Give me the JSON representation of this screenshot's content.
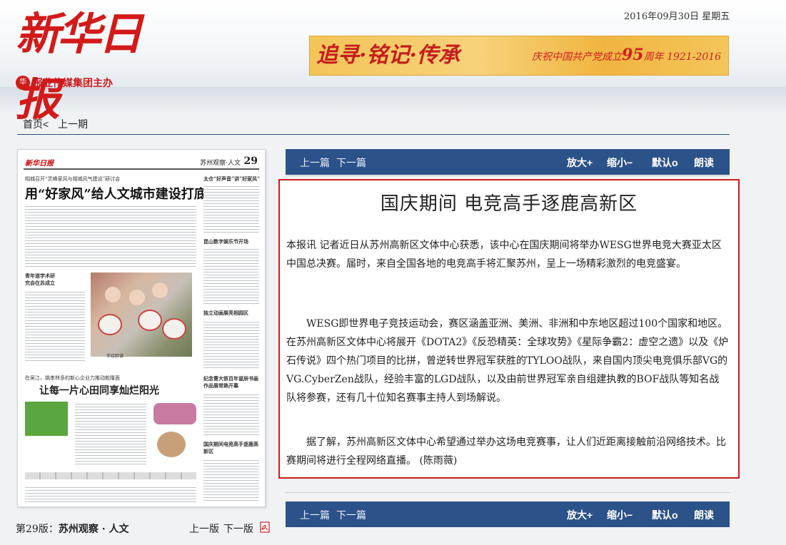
{
  "header": {
    "logo_text": "新华日报",
    "logo_sub": "报业传媒集团主办",
    "date": "2016年09月30日 星期五",
    "banner": {
      "left_text": "追寻·铭记·传承",
      "right_prefix": "庆祝中国共产党成立",
      "right_number": "95",
      "right_suffix": "周年 1921-2016"
    }
  },
  "breadcrumb": {
    "home": "首页<",
    "prev_issue": "上一期"
  },
  "thumbnail": {
    "mast_logo": "新华日报",
    "mast_section": "苏州观察·人文",
    "mast_number": "29",
    "kicker": "相城召开“灵峰家风与相城风气建设”研讨会",
    "headline": "用“好家风”给人文城市建设打底",
    "side_head_1": "太仓“好声音”讲“好家风”",
    "side_head_2": "昆山数字娱乐节开场",
    "left_section": "青年道学术研究会在苏成立",
    "side_head_3": "独立动画展亮相园区",
    "photo_caption": "手绘脸谱",
    "sub_kicker": "在吴江，姚孝林多的新心企业力推动乾隆面",
    "headline_2": "让每一片心田同享灿烂阳光",
    "side_head_4": "纪念曹大铁百年诞辰书画作品展常熟开幕",
    "side_head_5": "国庆期间电竞高手逐鹿高新区"
  },
  "page_footer": {
    "page_prefix": "第29版：",
    "page_name": "苏州观察 · 人文",
    "prev_page": "上一版",
    "next_page": "下一版"
  },
  "toolbar": {
    "prev_article": "上一篇",
    "next_article": "下一篇",
    "zoom_in": "放大+",
    "zoom_out": "缩小−",
    "default": "默认o",
    "read_aloud": "朗读"
  },
  "article": {
    "title": "国庆期间 电竞高手逐鹿高新区",
    "paragraphs": [
      "本报讯 记者近日从苏州高新区文体中心获悉，该中心在国庆期间将举办WESG世界电竞大赛亚太区中国总决赛。届时，来自全国各地的电竞高手将汇聚苏州，呈上一场精彩激烈的电竞盛宴。",
      "WESG即世界电子竞技运动会，赛区涵盖亚洲、美洲、非洲和中东地区超过100个国家和地区。在苏州高新区文体中心将展开《DOTA2》《反恐精英：全球攻势》《星际争霸2：虚空之遗》以及《炉石传说》四个热门项目的比拼，曾逆转世界冠军获胜的TYLOO战队，来自国内顶尖电竞俱乐部VG的VG.CyberZen战队，经验丰富的LGD战队，以及由前世界冠军亲自组建执教的BOF战队等知名战队将参赛，还有几十位知名赛事主持人到场解说。",
      "据了解，苏州高新区文体中心希望通过举办这场电竞赛事，让人们近距离接触前沿网络技术。比赛期间将进行全程网络直播。 (陈雨薇)"
    ]
  },
  "colors": {
    "toolbar_bg": "#2b5289",
    "article_border": "#cc1b1b",
    "logo_red": "#d31a1a",
    "banner_gold": "#f3c457"
  }
}
